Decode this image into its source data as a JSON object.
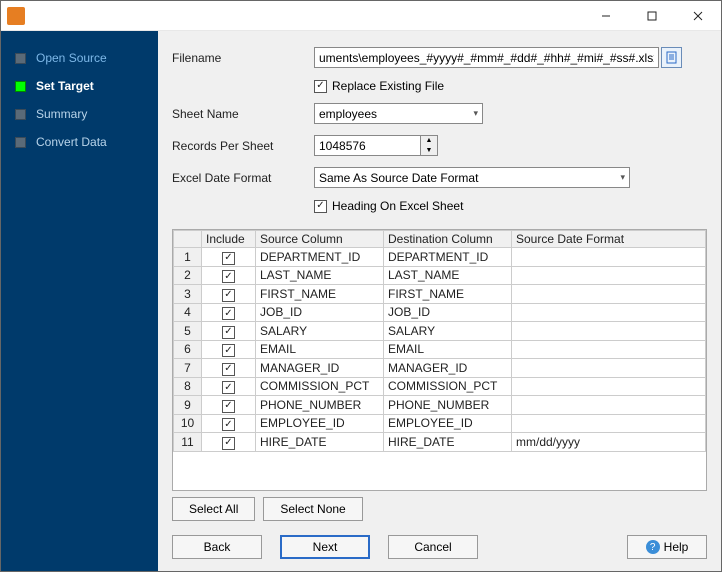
{
  "window": {
    "min": "—",
    "max": "□",
    "close": "✕"
  },
  "sidebar": {
    "items": [
      {
        "label": "Open Source",
        "active": false,
        "link": true
      },
      {
        "label": "Set Target",
        "active": true,
        "link": false
      },
      {
        "label": "Summary",
        "active": false,
        "link": false
      },
      {
        "label": "Convert Data",
        "active": false,
        "link": false
      }
    ]
  },
  "form": {
    "filename_label": "Filename",
    "filename_value": "uments\\employees_#yyyy#_#mm#_#dd#_#hh#_#mi#_#ss#.xlsx",
    "replace_label": "Replace Existing File",
    "replace_checked": true,
    "sheet_label": "Sheet Name",
    "sheet_value": "employees",
    "records_label": "Records Per Sheet",
    "records_value": "1048576",
    "dateformat_label": "Excel Date Format",
    "dateformat_value": "Same As Source Date Format",
    "heading_label": "Heading On Excel Sheet",
    "heading_checked": true
  },
  "grid": {
    "headers": [
      "",
      "Include",
      "Source Column",
      "Destination Column",
      "Source Date Format"
    ],
    "rows": [
      {
        "n": "1",
        "inc": true,
        "src": "DEPARTMENT_ID",
        "dst": "DEPARTMENT_ID",
        "fmt": ""
      },
      {
        "n": "2",
        "inc": true,
        "src": "LAST_NAME",
        "dst": "LAST_NAME",
        "fmt": ""
      },
      {
        "n": "3",
        "inc": true,
        "src": "FIRST_NAME",
        "dst": "FIRST_NAME",
        "fmt": ""
      },
      {
        "n": "4",
        "inc": true,
        "src": "JOB_ID",
        "dst": "JOB_ID",
        "fmt": ""
      },
      {
        "n": "5",
        "inc": true,
        "src": "SALARY",
        "dst": "SALARY",
        "fmt": ""
      },
      {
        "n": "6",
        "inc": true,
        "src": "EMAIL",
        "dst": "EMAIL",
        "fmt": ""
      },
      {
        "n": "7",
        "inc": true,
        "src": "MANAGER_ID",
        "dst": "MANAGER_ID",
        "fmt": ""
      },
      {
        "n": "8",
        "inc": true,
        "src": "COMMISSION_PCT",
        "dst": "COMMISSION_PCT",
        "fmt": ""
      },
      {
        "n": "9",
        "inc": true,
        "src": "PHONE_NUMBER",
        "dst": "PHONE_NUMBER",
        "fmt": ""
      },
      {
        "n": "10",
        "inc": true,
        "src": "EMPLOYEE_ID",
        "dst": "EMPLOYEE_ID",
        "fmt": ""
      },
      {
        "n": "11",
        "inc": true,
        "src": "HIRE_DATE",
        "dst": "HIRE_DATE",
        "fmt": "mm/dd/yyyy"
      }
    ]
  },
  "buttons": {
    "select_all": "Select All",
    "select_none": "Select None",
    "back": "Back",
    "next": "Next",
    "cancel": "Cancel",
    "help": "Help"
  }
}
